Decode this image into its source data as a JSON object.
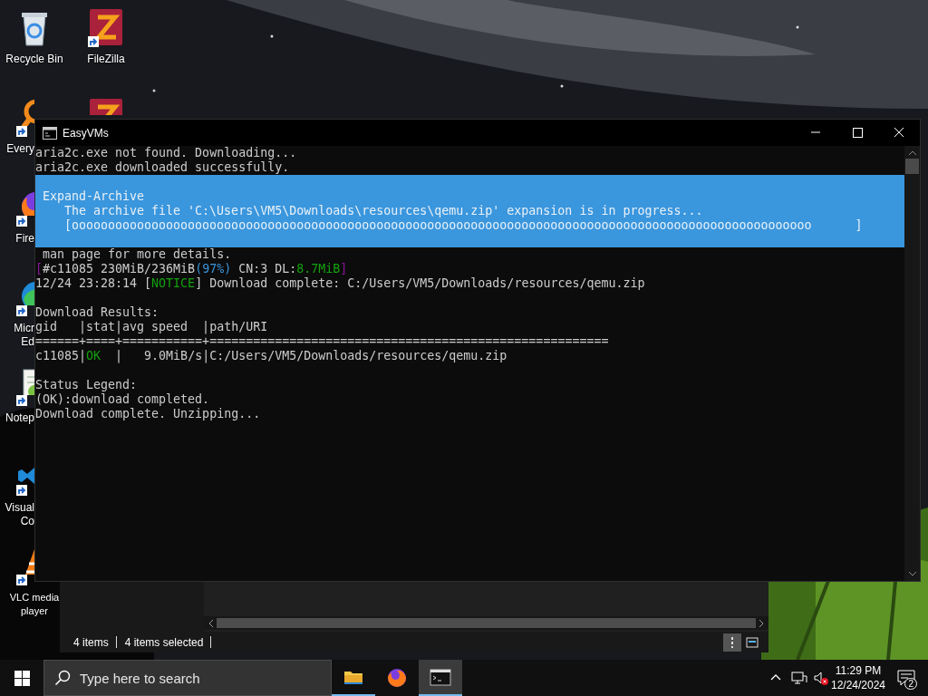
{
  "desktop": {
    "icons": [
      {
        "kind": "recycle",
        "shortcut": false,
        "label_lines": [
          "Recycle Bin"
        ]
      },
      {
        "kind": "filezilla",
        "shortcut": true,
        "label_lines": [
          "FileZilla"
        ]
      },
      {
        "kind": "everything",
        "shortcut": true,
        "label_lines": [
          "Every"
        ]
      },
      {
        "kind": "filezilla",
        "shortcut": false
      },
      {
        "kind": "firefox",
        "shortcut": true,
        "label_lines": [
          "Fire"
        ]
      },
      {
        "kind": "edge",
        "shortcut": true,
        "label_lines": [
          "Micr",
          "Ed"
        ]
      },
      {
        "kind": "notepad",
        "shortcut": true,
        "label_lines": [
          "Notep"
        ]
      },
      {
        "kind": "vscode",
        "shortcut": true,
        "label_lines": [
          "Visual",
          "Co"
        ]
      },
      {
        "kind": "vlc",
        "shortcut": true,
        "label_lines": [
          "VLC media",
          "player"
        ]
      }
    ]
  },
  "explorer": {
    "status": [
      "4 items",
      "4 items selected"
    ],
    "view_buttons": [
      {
        "kind": "details",
        "selected": true
      },
      {
        "kind": "tiles",
        "selected": false
      }
    ]
  },
  "console": {
    "title": "EasyVMs",
    "lines": [
      {
        "kind": "text",
        "segments": [
          {
            "text": "aria2c.exe not found. Downloading..."
          }
        ]
      },
      {
        "kind": "text",
        "segments": [
          {
            "text": "aria2c.exe downloaded successfully."
          }
        ]
      },
      {
        "kind": "progress",
        "title": "Expand-Archive",
        "message": "The archive file 'C:\\Users\\VM5\\Downloads\\resources\\qemu.zip' expansion is in progress...",
        "bar": "[oooooooooooooooooooooooooooooooooooooooooooooooooooooooooooooooooooooooooooooooooooooooooooooooooooooo      ]"
      },
      {
        "kind": "text",
        "segments": [
          {
            "text": " man page for more details."
          }
        ]
      },
      {
        "kind": "text",
        "segments": [
          {
            "text": "[",
            "color": "#881798"
          },
          {
            "text": "#c11085 230MiB/236MiB"
          },
          {
            "text": "(97%)",
            "color": "#3a96dd"
          },
          {
            "text": " CN:3 DL:"
          },
          {
            "text": "8.7MiB",
            "color": "#13a10e"
          },
          {
            "text": "]",
            "color": "#881798"
          }
        ]
      },
      {
        "kind": "text",
        "segments": [
          {
            "text": "12/24 23:28:14 ["
          },
          {
            "text": "NOTICE",
            "color": "#13a10e"
          },
          {
            "text": "] Download complete: C:/Users/VM5/Downloads/resources/qemu.zip"
          }
        ]
      },
      {
        "kind": "blank"
      },
      {
        "kind": "text",
        "segments": [
          {
            "text": "Download Results:"
          }
        ]
      },
      {
        "kind": "text",
        "segments": [
          {
            "text": "gid   |stat|avg speed  |path/URI"
          }
        ]
      },
      {
        "kind": "text",
        "segments": [
          {
            "text": "======+====+===========+======================================================="
          }
        ]
      },
      {
        "kind": "text",
        "segments": [
          {
            "text": "c11085|"
          },
          {
            "text": "OK",
            "color": "#13a10e"
          },
          {
            "text": "  |   9.0MiB/s|C:/Users/VM5/Downloads/resources/qemu.zip"
          }
        ]
      },
      {
        "kind": "blank"
      },
      {
        "kind": "text",
        "segments": [
          {
            "text": "Status Legend:"
          }
        ]
      },
      {
        "kind": "text",
        "segments": [
          {
            "text": "(OK):download completed."
          }
        ]
      },
      {
        "kind": "text",
        "segments": [
          {
            "text": "Download complete. Unzipping..."
          }
        ]
      }
    ]
  },
  "taskbar": {
    "search": {
      "placeholder": "Type here to search"
    },
    "apps": [
      {
        "kind": "folder",
        "running": true,
        "selected": false
      },
      {
        "kind": "firefox",
        "running": false,
        "selected": false
      },
      {
        "kind": "terminal",
        "running": true,
        "selected": true
      }
    ],
    "time": "11:29 PM",
    "date": "12/24/2024",
    "notification_count": "2"
  }
}
